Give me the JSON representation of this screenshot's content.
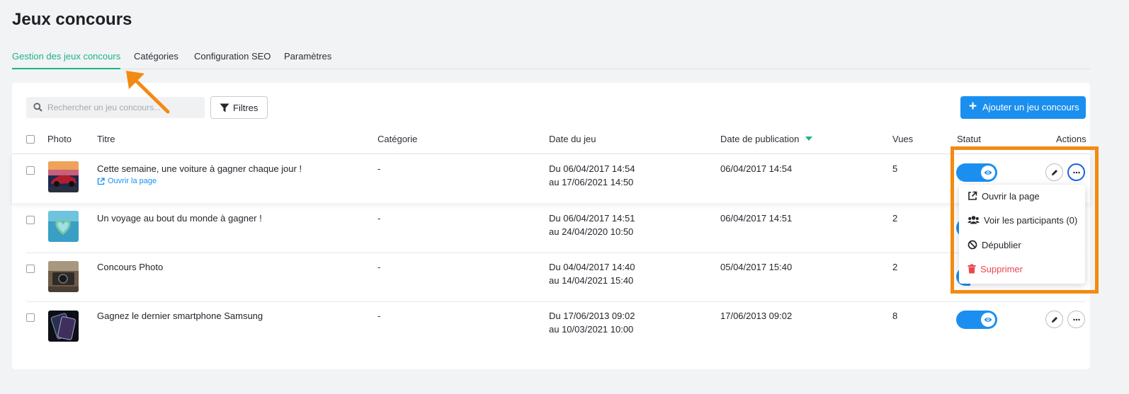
{
  "page_title": "Jeux concours",
  "tabs": [
    {
      "label": "Gestion des jeux concours",
      "active": true
    },
    {
      "label": "Catégories"
    },
    {
      "label": "Configuration SEO"
    },
    {
      "label": "Paramètres"
    }
  ],
  "search": {
    "placeholder": "Rechercher un jeu concours..."
  },
  "filter_label": "Filtres",
  "add_label": "Ajouter un jeu concours",
  "columns": {
    "photo": "Photo",
    "title": "Titre",
    "category": "Catégorie",
    "game_date": "Date du jeu",
    "publication_date": "Date de publication",
    "views": "Vues",
    "status": "Statut",
    "actions": "Actions"
  },
  "rows": [
    {
      "title": "Cette semaine, une voiture à gagner chaque jour !",
      "link": "Ouvrir la page",
      "category": "-",
      "date_start": "Du 06/04/2017 14:54",
      "date_end": "au 17/06/2021 14:50",
      "publication": "06/04/2017 14:54",
      "views": "5",
      "thumb": "car"
    },
    {
      "title": "Un voyage au bout du monde à gagner !",
      "category": "-",
      "date_start": "Du 06/04/2017 14:51",
      "date_end": "au 24/04/2020 10:50",
      "publication": "06/04/2017 14:51",
      "views": "2",
      "thumb": "island"
    },
    {
      "title": "Concours Photo",
      "category": "-",
      "date_start": "Du 04/04/2017 14:40",
      "date_end": "au 14/04/2021 15:40",
      "publication": "05/04/2017 15:40",
      "views": "2",
      "thumb": "camera"
    },
    {
      "title": "Gagnez le dernier smartphone Samsung",
      "category": "-",
      "date_start": "Du 17/06/2013 09:02",
      "date_end": "au 10/03/2021 10:00",
      "publication": "17/06/2013 09:02",
      "views": "8",
      "thumb": "phone"
    }
  ],
  "dropdown": {
    "open_page": "Ouvrir la page",
    "participants": "Voir les participants (0)",
    "unpublish": "Dépublier",
    "delete": "Supprimer"
  },
  "colors": {
    "accent_green": "#1ab38a",
    "primary_blue": "#1a8ff0",
    "danger": "#e8474f",
    "highlight_orange": "#f38a12"
  }
}
